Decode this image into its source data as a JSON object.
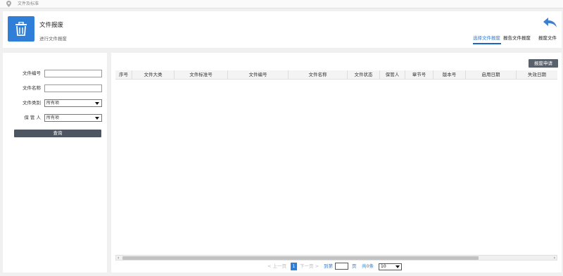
{
  "breadcrumb": {
    "text": "文件及标准",
    "icon": "location-pin-icon"
  },
  "header": {
    "title": "文件报废",
    "subtitle": "进行文件报废",
    "icon": "trash-icon",
    "back_icon": "back-arrow-icon",
    "tabs": [
      {
        "label": "选择文件报废",
        "active": true
      },
      {
        "label": "报告文件报废",
        "active": false
      },
      {
        "label": "报废文件",
        "active": false
      }
    ]
  },
  "filter": {
    "file_no_label": "文件编号",
    "file_no_value": "",
    "file_name_label": "文件名称",
    "file_name_value": "",
    "file_category_label": "文件类别",
    "file_category_value": "所有项",
    "custodian_label": "保 管 人",
    "custodian_value": "所有项",
    "query_label": "查询"
  },
  "toolbar": {
    "apply_label": "报废申请"
  },
  "table": {
    "columns": [
      "序号",
      "文件大类",
      "文件标准号",
      "文件编号",
      "文件名称",
      "文件状态",
      "保管人",
      "章节号",
      "版本号",
      "启用日期",
      "失效日期"
    ],
    "rows": []
  },
  "pagination": {
    "prev_label": "< 上一页",
    "current_page": "1",
    "next_label": "下一页 >",
    "goto_label": "到第",
    "page_value": "",
    "page_unit": "页",
    "total_label": "共0条",
    "page_size": "10"
  },
  "colors": {
    "accent": "#2f7ed8",
    "button_dark": "#4d5560"
  }
}
